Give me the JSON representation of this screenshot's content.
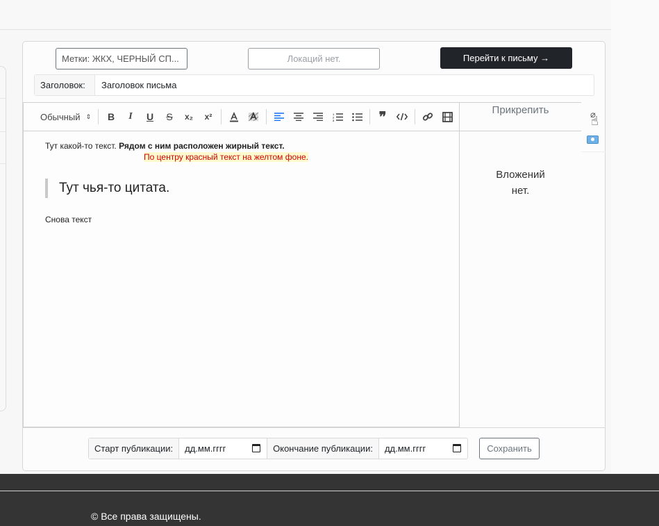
{
  "header": {
    "tags_value": "Метки: ЖКХ, ЧЕРНЫЙ СП...",
    "location_label": "Локаций нет.",
    "goto_label": "Перейти к письму →"
  },
  "title_field": {
    "label": "Заголовок:",
    "value": "Заголовок письма"
  },
  "toolbar": {
    "format_select": "Обычный",
    "format_arrows": "⇕",
    "buttons": [
      {
        "name": "bold",
        "glyph": "B"
      },
      {
        "name": "italic",
        "glyph": "I"
      },
      {
        "name": "underline",
        "glyph": "U"
      },
      {
        "name": "strike",
        "glyph": "S"
      },
      {
        "name": "subscript",
        "glyph": "x₂"
      },
      {
        "name": "superscript",
        "glyph": "x²"
      }
    ]
  },
  "content": {
    "line1_plain": "Тут какой-то текст. ",
    "line1_bold": "Рядом с ним расположен жирный текст.",
    "line2": "По центру красный текст на желтом фоне.",
    "quote": "Тут чья-то цитата.",
    "line3": "Снова текст"
  },
  "attachments": {
    "header": "Прикрепить",
    "empty": "Вложений нет."
  },
  "publication": {
    "start_label": "Старт публикации:",
    "start_value": "дд.мм.гггг",
    "end_label": "Окончание публикации:",
    "end_value": "дд.мм.гггг",
    "save_label": "Сохранить"
  },
  "footer": {
    "copyright": "© Все права защищены."
  },
  "colors": {
    "accent": "#0d6efd",
    "dark": "#212529",
    "footer_bg": "#343434",
    "highlight_bg": "#fffacd",
    "highlight_text": "#d10000"
  }
}
